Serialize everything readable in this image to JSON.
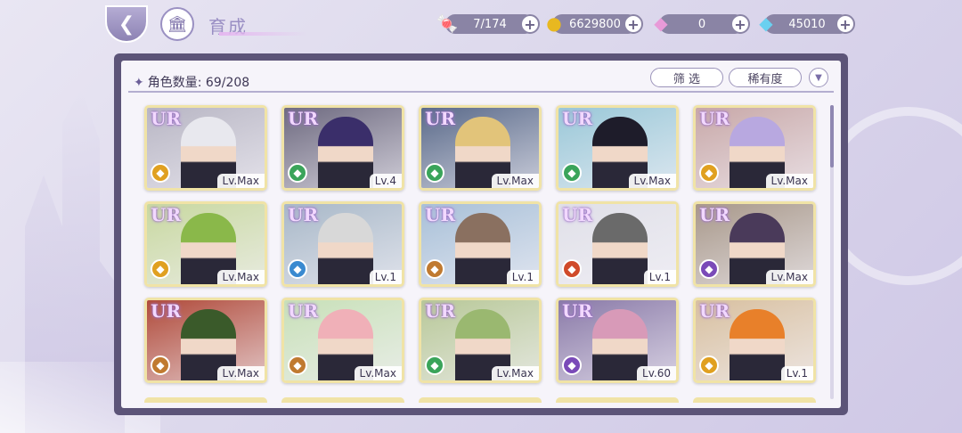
{
  "header": {
    "title": "育成",
    "back_icon": "back-arrow-icon",
    "home_icon": "castle-home-icon"
  },
  "currencies": [
    {
      "name": "candy",
      "icon": "candy-icon",
      "value": "7/174"
    },
    {
      "name": "coin",
      "icon": "coin-icon",
      "value": "6629800"
    },
    {
      "name": "pink_gem",
      "icon": "pink-diamond-icon",
      "value": "0"
    },
    {
      "name": "blue_gem",
      "icon": "blue-diamond-icon",
      "value": "45010"
    }
  ],
  "panel": {
    "count_label": "角色数量:",
    "count_value": "69/208",
    "filter_label": "筛 选",
    "rarity_label": "稀有度",
    "sort_icon": "chevron-down-icon"
  },
  "cards": [
    {
      "rarity": "UR",
      "level": "Lv.Max",
      "element_color": "#e0a020",
      "bg": "#b8b6c4",
      "hair": "#e8e8ee"
    },
    {
      "rarity": "UR",
      "level": "Lv.4",
      "element_color": "#3aa45a",
      "bg": "#6e6a80",
      "hair": "#3a2e6a"
    },
    {
      "rarity": "UR",
      "level": "Lv.Max",
      "element_color": "#3aa45a",
      "bg": "#5a6a8a",
      "hair": "#e2c47a"
    },
    {
      "rarity": "UR",
      "level": "Lv.Max",
      "element_color": "#3aa45a",
      "bg": "#9ac8d8",
      "hair": "#1e1c2a"
    },
    {
      "rarity": "UR",
      "level": "Lv.Max",
      "element_color": "#e0a020",
      "bg": "#c8a8a8",
      "hair": "#b8a8e0"
    },
    {
      "rarity": "UR",
      "level": "Lv.Max",
      "element_color": "#e0a020",
      "bg": "#c8d8a0",
      "hair": "#8ab84a"
    },
    {
      "rarity": "UR",
      "level": "Lv.1",
      "element_color": "#3a8ad0",
      "bg": "#a8b8c8",
      "hair": "#d8d8d8"
    },
    {
      "rarity": "UR",
      "level": "Lv.1",
      "element_color": "#c07a30",
      "bg": "#a8c0d8",
      "hair": "#8a7060"
    },
    {
      "rarity": "UR",
      "level": "Lv.1",
      "element_color": "#d04a2a",
      "bg": "#e0e0e8",
      "hair": "#6a6a6a"
    },
    {
      "rarity": "UR",
      "level": "Lv.Max",
      "element_color": "#7a4ab8",
      "bg": "#a8988a",
      "hair": "#4a3a5a"
    },
    {
      "rarity": "UR",
      "level": "Lv.Max",
      "element_color": "#c07a30",
      "bg": "#b04a3a",
      "hair": "#3a5a2a"
    },
    {
      "rarity": "UR",
      "level": "Lv.Max",
      "element_color": "#c07a30",
      "bg": "#c8e0b8",
      "hair": "#f0b0b8"
    },
    {
      "rarity": "UR",
      "level": "Lv.Max",
      "element_color": "#3aa45a",
      "bg": "#b8c898",
      "hair": "#9ab870"
    },
    {
      "rarity": "UR",
      "level": "Lv.60",
      "element_color": "#7a4ab8",
      "bg": "#8a7aa8",
      "hair": "#d89ab8"
    },
    {
      "rarity": "UR",
      "level": "Lv.1",
      "element_color": "#e0a020",
      "bg": "#d8c0a0",
      "hair": "#e8802a"
    }
  ]
}
